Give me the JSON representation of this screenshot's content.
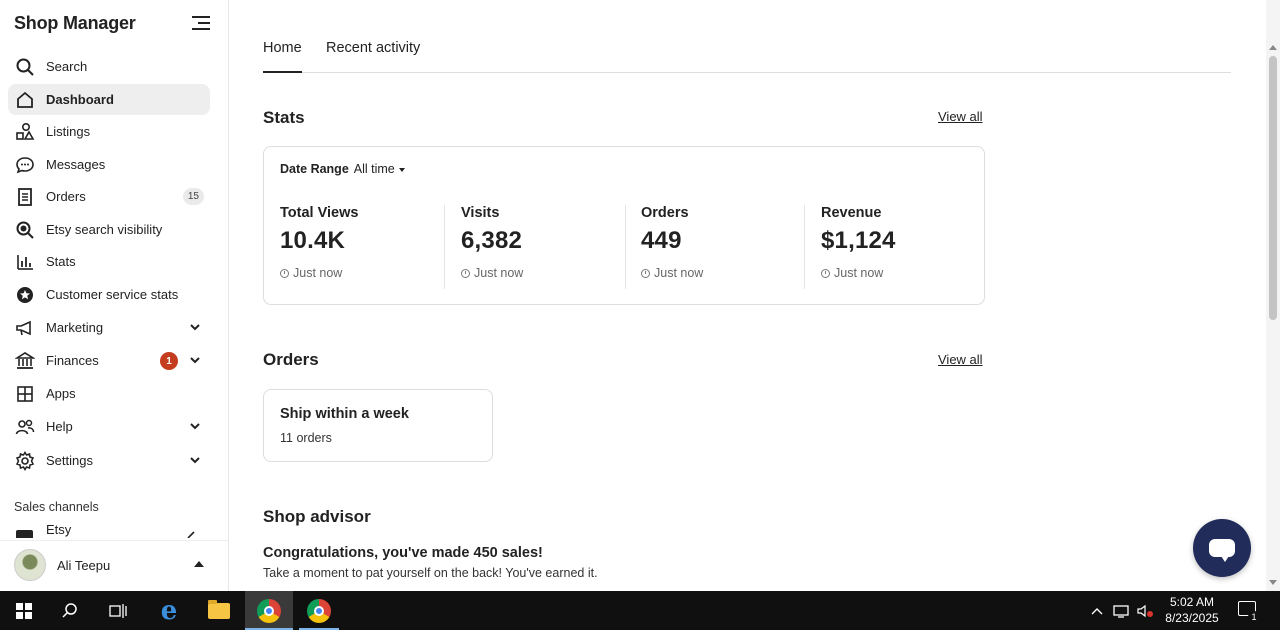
{
  "sidebar": {
    "title": "Shop Manager",
    "items": [
      {
        "label": "Search",
        "icon": "search-icon"
      },
      {
        "label": "Dashboard",
        "icon": "home-icon",
        "active": true
      },
      {
        "label": "Listings",
        "icon": "shapes-icon"
      },
      {
        "label": "Messages",
        "icon": "chat-icon"
      },
      {
        "label": "Orders",
        "icon": "receipt-icon",
        "badge": "15"
      },
      {
        "label": "Etsy search visibility",
        "icon": "magnifier-icon"
      },
      {
        "label": "Stats",
        "icon": "bar-chart-icon"
      },
      {
        "label": "Customer service stats",
        "icon": "star-badge-icon"
      },
      {
        "label": "Marketing",
        "icon": "megaphone-icon"
      },
      {
        "label": "Finances",
        "icon": "bank-icon",
        "alert": "1"
      },
      {
        "label": "Apps",
        "icon": "grid-icon"
      },
      {
        "label": "Help",
        "icon": "people-icon"
      },
      {
        "label": "Settings",
        "icon": "gear-icon"
      }
    ],
    "sales_channels_label": "Sales channels",
    "channel": "Etsy",
    "user_name": "Ali Teepu"
  },
  "tabs": [
    "Home",
    "Recent activity"
  ],
  "stats": {
    "title": "Stats",
    "view_all": "View all",
    "date_range_label": "Date Range",
    "date_range_value": "All time",
    "metrics": [
      {
        "label": "Total Views",
        "value": "10.4K",
        "time": "Just now"
      },
      {
        "label": "Visits",
        "value": "6,382",
        "time": "Just now"
      },
      {
        "label": "Orders",
        "value": "449",
        "time": "Just now"
      },
      {
        "label": "Revenue",
        "value": "$1,124",
        "time": "Just now"
      }
    ]
  },
  "orders": {
    "title": "Orders",
    "view_all": "View all",
    "card_title": "Ship within a week",
    "card_sub": "11 orders"
  },
  "advisor": {
    "title": "Shop advisor",
    "headline": "Congratulations, you've made 450 sales!",
    "sub": "Take a moment to pat yourself on the back! You've earned it."
  },
  "taskbar": {
    "time": "5:02 AM",
    "date": "8/23/2025",
    "notification_count": "1"
  },
  "colors": {
    "alert": "#c43d1e",
    "chat_button": "#222c5a",
    "active_nav": "#eeeeee"
  }
}
